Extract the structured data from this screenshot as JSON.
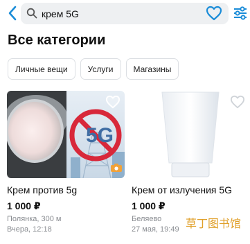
{
  "search": {
    "value": "крем 5G",
    "placeholder": ""
  },
  "icons": {
    "back": "chevron-left-icon",
    "search": "search-icon",
    "favorite": "heart-icon",
    "filter": "filter-sliders-icon"
  },
  "section_title": "Все категории",
  "chips": [
    {
      "label": "Личные вещи"
    },
    {
      "label": "Услуги"
    },
    {
      "label": "Магазины"
    }
  ],
  "listings": [
    {
      "title": "Крем против 5g",
      "price": "1 000 ₽",
      "location": "Полянка, 300 м",
      "date": "Вчера, 12:18",
      "image_text": "5G"
    },
    {
      "title": "Крем от излучения 5G",
      "price": "1 000 ₽",
      "location": "Беляево",
      "date": "27 мая, 19:49"
    }
  ],
  "watermark": "草丁图书馆",
  "colors": {
    "accent": "#1a8cd8",
    "chip_border": "#dcdfe3",
    "muted_text": "#8a8d92",
    "search_bg": "#eef0f2",
    "no_sign": "#d8283a"
  }
}
